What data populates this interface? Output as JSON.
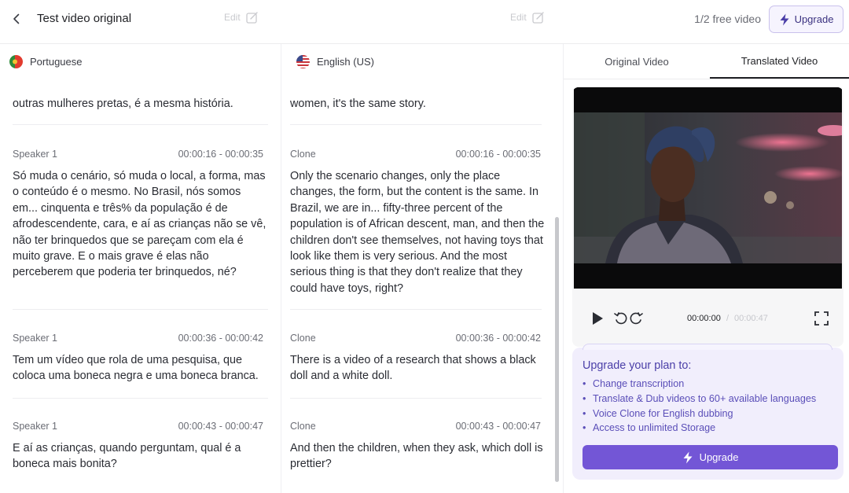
{
  "header": {
    "title": "Test video original",
    "free_label": "1/2 free video",
    "upgrade_label": "Upgrade"
  },
  "columns": {
    "source": {
      "language": "Portuguese",
      "edit_label": "Edit"
    },
    "target": {
      "language": "English (US)",
      "edit_label": "Edit"
    }
  },
  "segments": [
    {
      "speaker": "",
      "time": "",
      "source_text": "outras mulheres pretas, é a mesma história.",
      "target_speaker": "",
      "target_time": "",
      "target_text": "women, it's the same story."
    },
    {
      "speaker": "Speaker 1",
      "time": "00:00:16 - 00:00:35",
      "source_text": "Só muda o cenário, só muda o local, a forma, mas o conteúdo é o mesmo. No Brasil, nós somos em... cinquenta e três% da população é de afrodescendente, cara, e aí as crianças não se vê, não ter brinquedos que se pareçam com ela é muito grave. E o mais grave é elas não perceberem que poderia ter brinquedos, né?",
      "target_speaker": "Clone",
      "target_time": "00:00:16 - 00:00:35",
      "target_text": "Only the scenario changes, only the place changes, the form, but the content is the same. In Brazil, we are in... fifty-three percent of the population is of African descent, man, and then the children don't see themselves, not having toys that look like them is very serious. And the most serious thing is that they don't realize that they could have toys, right?"
    },
    {
      "speaker": "Speaker 1",
      "time": "00:00:36 - 00:00:42",
      "source_text": "Tem um vídeo que rola de uma pesquisa, que coloca uma boneca negra e uma boneca branca.",
      "target_speaker": "Clone",
      "target_time": "00:00:36 - 00:00:42",
      "target_text": "There is a video of a research that shows a black doll and a white doll."
    },
    {
      "speaker": "Speaker 1",
      "time": "00:00:43 - 00:00:47",
      "source_text": "E aí as crianças, quando perguntam, qual é a boneca mais bonita?",
      "target_speaker": "Clone",
      "target_time": "00:00:43 - 00:00:47",
      "target_text": "And then the children, when they ask, which doll is prettier?"
    }
  ],
  "tabs": {
    "original": "Original Video",
    "translated": "Translated Video",
    "active": "translated"
  },
  "player": {
    "current_time": "00:00:00",
    "separator": "/",
    "duration": "00:00:47"
  },
  "promo": {
    "title": "Upgrade your plan to:",
    "items": [
      "Change transcription",
      "Translate & Dub videos to 60+ available languages",
      "Voice Clone for English dubbing",
      "Access to unlimited Storage"
    ],
    "button_label": "Upgrade"
  },
  "colors": {
    "accent": "#7356d6",
    "promo_bg": "#f1eefc",
    "promo_text": "#5a4eb8"
  },
  "icons": {
    "back": "chevron-left-icon",
    "upgrade": "lightning-icon",
    "edit": "edit-icon",
    "play": "play-icon",
    "rewind": "rewind-icon",
    "forward": "forward-icon",
    "fullscreen": "fullscreen-icon"
  }
}
